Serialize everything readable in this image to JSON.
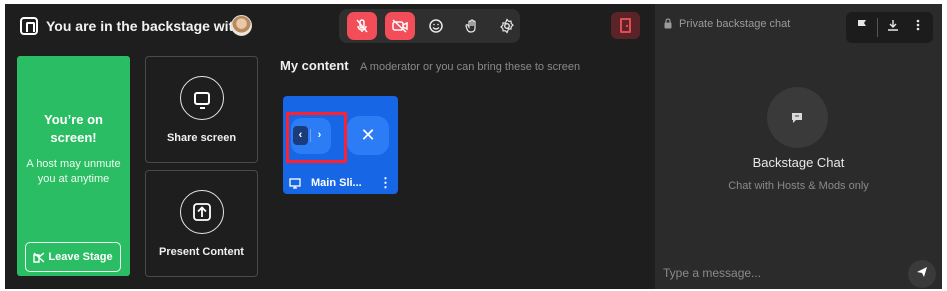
{
  "header": {
    "title": "You are in the backstage with"
  },
  "toolbar": {
    "buttons": [
      {
        "name": "mic-off-icon",
        "glyph": "🎙",
        "active": true
      },
      {
        "name": "camera-off-icon",
        "glyph": "▣",
        "active": true
      },
      {
        "name": "emoji-icon",
        "glyph": "☺",
        "active": false
      },
      {
        "name": "raise-hand-icon",
        "glyph": "✋",
        "active": false
      },
      {
        "name": "settings-icon",
        "glyph": "⚙",
        "active": false
      }
    ]
  },
  "onscreen": {
    "heading": "You’re on screen!",
    "subtext": "A host may unmute you at anytime",
    "leave_label": "Leave Stage"
  },
  "actions": {
    "share_screen_label": "Share screen",
    "present_content_label": "Present Content"
  },
  "my_content": {
    "title": "My content",
    "subtitle": "A moderator or you can bring these to screen",
    "item": {
      "name": "Main Sli...",
      "prev_glyph": "‹",
      "next_glyph": "›",
      "close_glyph": "✕",
      "more_glyph": "⋮"
    }
  },
  "chat": {
    "panel_title": "Private backstage chat",
    "empty_heading": "Backstage Chat",
    "empty_subtext": "Chat with Hosts & Mods only",
    "input_placeholder": "Type a message..."
  },
  "colors": {
    "stage_bg": "#1e1e1e",
    "chat_bg": "#2b2b2b",
    "onscreen_green": "#2bbd63",
    "alert_red": "#f24d58",
    "slide_blue": "#1666e6",
    "highlight_red": "#ff1f2e"
  }
}
